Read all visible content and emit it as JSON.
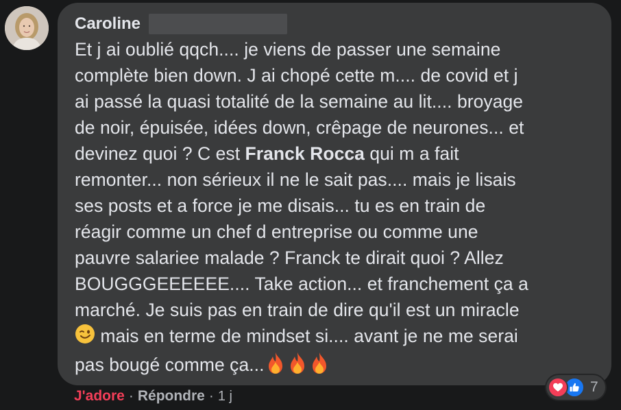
{
  "comment": {
    "author": "Caroline",
    "lines": [
      "Et j ai oublié qqch.... je viens de passer une semaine",
      "complète bien down. J ai chopé cette m.... de covid et j",
      "ai passé la quasi totalité de la semaine au lit.... broyage",
      "de noir, épuisée, idées down, crêpage de neurones... et"
    ],
    "line5_before": "devinez quoi ? C est ",
    "line5_mention": "Franck Rocca",
    "line5_after": " qui m a fait",
    "lines_rest": [
      "remonter... non sérieux il ne le sait pas.... mais je lisais",
      "ses posts et a force je me disais... tu es en train de",
      "réagir comme un chef d entreprise ou comme une",
      "pauvre salariee malade ? Franck te dirait quoi ? Allez",
      "BOUGGGEEEEEE.... Take action... et franchement ça a",
      "marché. Je suis pas en train de dire qu'il est un miracle"
    ],
    "line12_after_emoji": " mais en terme de mindset si.... avant je ne me serai",
    "line13": "pas bougé comme ça..."
  },
  "actions": {
    "like_label": "J'adore",
    "separator": "·",
    "reply_label": "Répondre",
    "time": "1 j"
  },
  "reactions": {
    "icons": [
      "love-icon",
      "like-icon"
    ],
    "count": "7"
  },
  "emojis": {
    "wink": "winking-face",
    "fire": "fire"
  }
}
